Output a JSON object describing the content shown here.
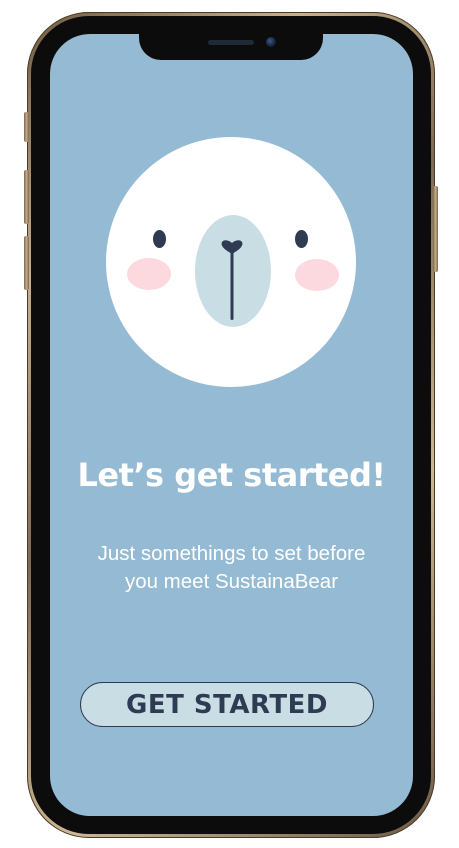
{
  "colors": {
    "screen_background": "#95bad3",
    "bear_face": "#ffffff",
    "eyes": "#2e3b52",
    "cheeks": "#fcd9de",
    "muzzle": "#c8dde4",
    "nose": "#2e3b52",
    "title_text": "#ffffff",
    "button_fill": "#c8dde4",
    "button_text": "#2e3b52"
  },
  "onboarding": {
    "title": "Let’s get started!",
    "subtitle_line1": "Just somethings to set before",
    "subtitle_line2": "you meet SustainaBear",
    "button_label": "GET STARTED"
  },
  "icons": {
    "mascot": "polar-bear-face-icon"
  }
}
